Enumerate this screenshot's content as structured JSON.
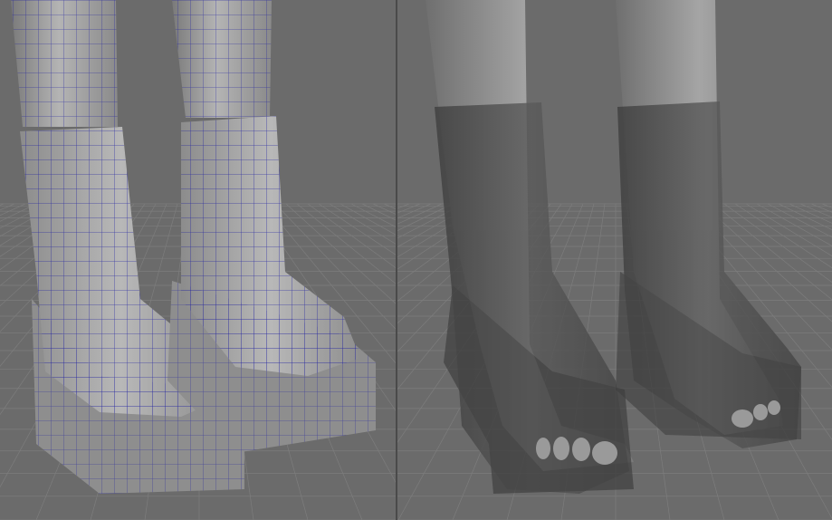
{
  "viewports": [
    {
      "id": "wireframe-on-shaded",
      "shading": "wireframe-on-shaded"
    },
    {
      "id": "xray-shaded",
      "shading": "x-ray"
    }
  ],
  "colors": {
    "background": "#6b6b6b",
    "grid_line": "#7d7d7d",
    "grid_line_dark": "#5e5e5e",
    "mesh_shaded": "#a9a9a9",
    "mesh_shadow": "#7c7c7c",
    "wireframe": "#1a1aa0",
    "xray_boot": "#4b4b4b",
    "xray_skin": "#9a9a9a"
  }
}
